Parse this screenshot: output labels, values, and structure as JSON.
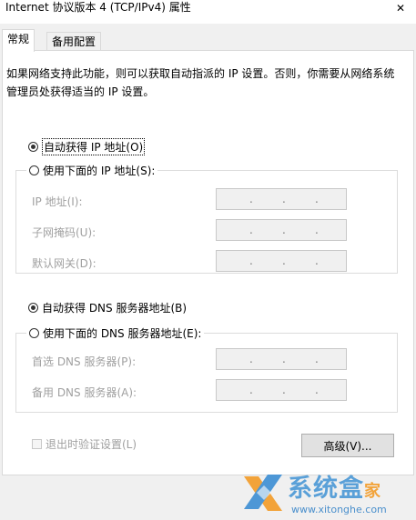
{
  "window": {
    "title": "Internet 协议版本 4 (TCP/IPv4) 属性",
    "close_icon": "✕"
  },
  "tabs": [
    {
      "label": "常规"
    },
    {
      "label": "备用配置"
    }
  ],
  "description": "如果网络支持此功能，则可以获取自动指派的 IP 设置。否则，你需要从网络系统管理员处获得适当的 IP 设置。",
  "ip": {
    "auto_label": "自动获得 IP 地址(O)",
    "manual_label": "使用下面的 IP 地址(S):",
    "auto_selected": true,
    "fields": [
      {
        "label": "IP 地址(I):",
        "value": ".   .   ."
      },
      {
        "label": "子网掩码(U):",
        "value": ".   .   ."
      },
      {
        "label": "默认网关(D):",
        "value": ".   .   ."
      }
    ]
  },
  "dns": {
    "auto_label": "自动获得 DNS 服务器地址(B)",
    "manual_label": "使用下面的 DNS 服务器地址(E):",
    "auto_selected": true,
    "fields": [
      {
        "label": "首选 DNS 服务器(P):",
        "value": ".   .   ."
      },
      {
        "label": "备用 DNS 服务器(A):",
        "value": ".   .   ."
      }
    ]
  },
  "validate_label": "退出时验证设置(L)",
  "validate_checked": false,
  "advanced_button": "高级(V)...",
  "watermark": {
    "text": "系统盒",
    "suffix": "家",
    "url": "www.xitonghe.com"
  }
}
